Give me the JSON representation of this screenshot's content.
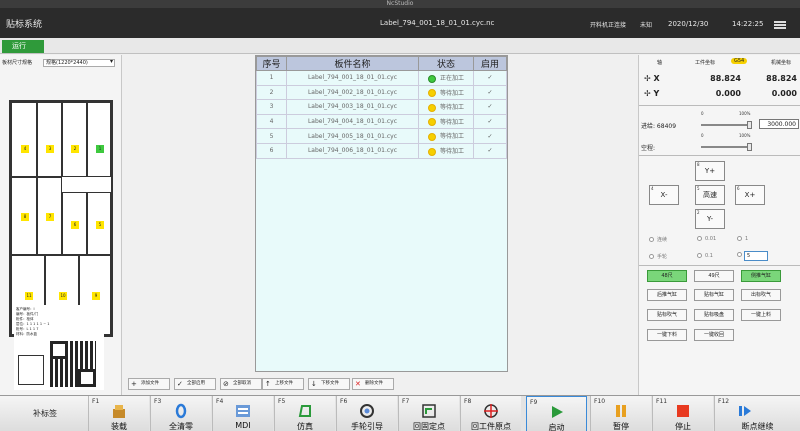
{
  "window": {
    "title": "NcStudio"
  },
  "header": {
    "app_title": "贴标系统",
    "file_name": "Label_794_001_18_01_01.cyc.nc",
    "connection": "开料机正连接",
    "unknown": "未知",
    "date": "2020/12/30",
    "time": "14:22:25"
  },
  "tab": {
    "run": "运行"
  },
  "left": {
    "sheet_label": "板材尺寸规格",
    "sheet_value": "规格(1220*2440)",
    "pieces": [
      "4",
      "3",
      "2",
      "1",
      "8",
      "7",
      "6",
      "5",
      "11",
      "10",
      "9"
    ],
    "qr_info": [
      "客户编号：I",
      "编号：板件/门",
      "柜件：柜体",
      "层位：1 1 1 1 1 ~ 1",
      "柜号：L 1 1 7",
      "材料：防水蓝",
      "PO：06/673-O",
      "颜色：亮白",
      "尺寸：P 00 × P 00 × 00",
      "包装：P"
    ]
  },
  "table": {
    "headers": [
      "序号",
      "板件名称",
      "状态",
      "启用"
    ],
    "rows": [
      {
        "idx": "1",
        "name": "Label_794_001_18_01_01.cyc",
        "status": "正在加工",
        "active": true
      },
      {
        "idx": "2",
        "name": "Label_794_002_18_01_01.cyc",
        "status": "等待加工",
        "active": false
      },
      {
        "idx": "3",
        "name": "Label_794_003_18_01_01.cyc",
        "status": "等待加工",
        "active": false
      },
      {
        "idx": "4",
        "name": "Label_794_004_18_01_01.cyc",
        "status": "等待加工",
        "active": false
      },
      {
        "idx": "5",
        "name": "Label_794_005_18_01_01.cyc",
        "status": "等待加工",
        "active": false
      },
      {
        "idx": "6",
        "name": "Label_794_006_18_01_01.cyc",
        "status": "等待加工",
        "active": false
      }
    ]
  },
  "actions": {
    "add_file": "添加文件",
    "enable_all": "全部启用",
    "cancel_all": "全部取消",
    "move_up": "上移文件",
    "move_down": "下移文件",
    "delete": "删除文件"
  },
  "coords": {
    "axis_label": "轴",
    "work_label": "工件坐标",
    "g54": "G54",
    "machine_label": "机械坐标",
    "x_label": "X",
    "y_label": "Y",
    "x_work": "88.824",
    "x_mach": "88.824",
    "y_work": "0.000",
    "y_mach": "0.000"
  },
  "feed": {
    "feed_label": "进给: 68409",
    "feed_value": "3000.000",
    "rapid_label": "空程:",
    "tick0": "0",
    "tick100": "100%",
    "feed_override": 0.95,
    "rapid_override": 0.95
  },
  "jog": {
    "yplus": "Y+",
    "yminus": "Y-",
    "xminus": "X-",
    "xplus": "X+",
    "fast": "高速",
    "k8": "8",
    "k2": "2",
    "k4": "4",
    "k6": "6",
    "k5": "5",
    "continuous": "连续",
    "step01": "0.01",
    "step1": "1",
    "handwheel": "手轮",
    "step_01": "0.1",
    "step_value": "5"
  },
  "io": {
    "b48": "48尺",
    "b49": "49尺",
    "b_side": "侧推气缸",
    "b_rear": "后推气缸",
    "b_label_cyl": "贴标气缸",
    "b_blow_out": "出标吹气",
    "b_label_blow": "贴标吹气",
    "b_label_suck": "贴标吸盘",
    "b_one_load": "一键上料",
    "b_one_unload": "一键下料",
    "b_one_collect": "一键收回"
  },
  "fkeys": {
    "replenish": "补标签",
    "f1": "F1",
    "f1_label": "装载",
    "f3": "F3",
    "f3_label": "全清零",
    "f4": "F4",
    "f4_label": "MDI",
    "f5": "F5",
    "f5_label": "仿真",
    "f6": "F6",
    "f6_label": "手轮引导",
    "f7": "F7",
    "f7_label": "回固定点",
    "f8": "F8",
    "f8_label": "回工件原点",
    "f9": "F9",
    "f9_label": "启动",
    "f10": "F10",
    "f10_label": "暂停",
    "f11": "F11",
    "f11_label": "停止",
    "f12": "F12",
    "f12_label": "断点继续"
  }
}
